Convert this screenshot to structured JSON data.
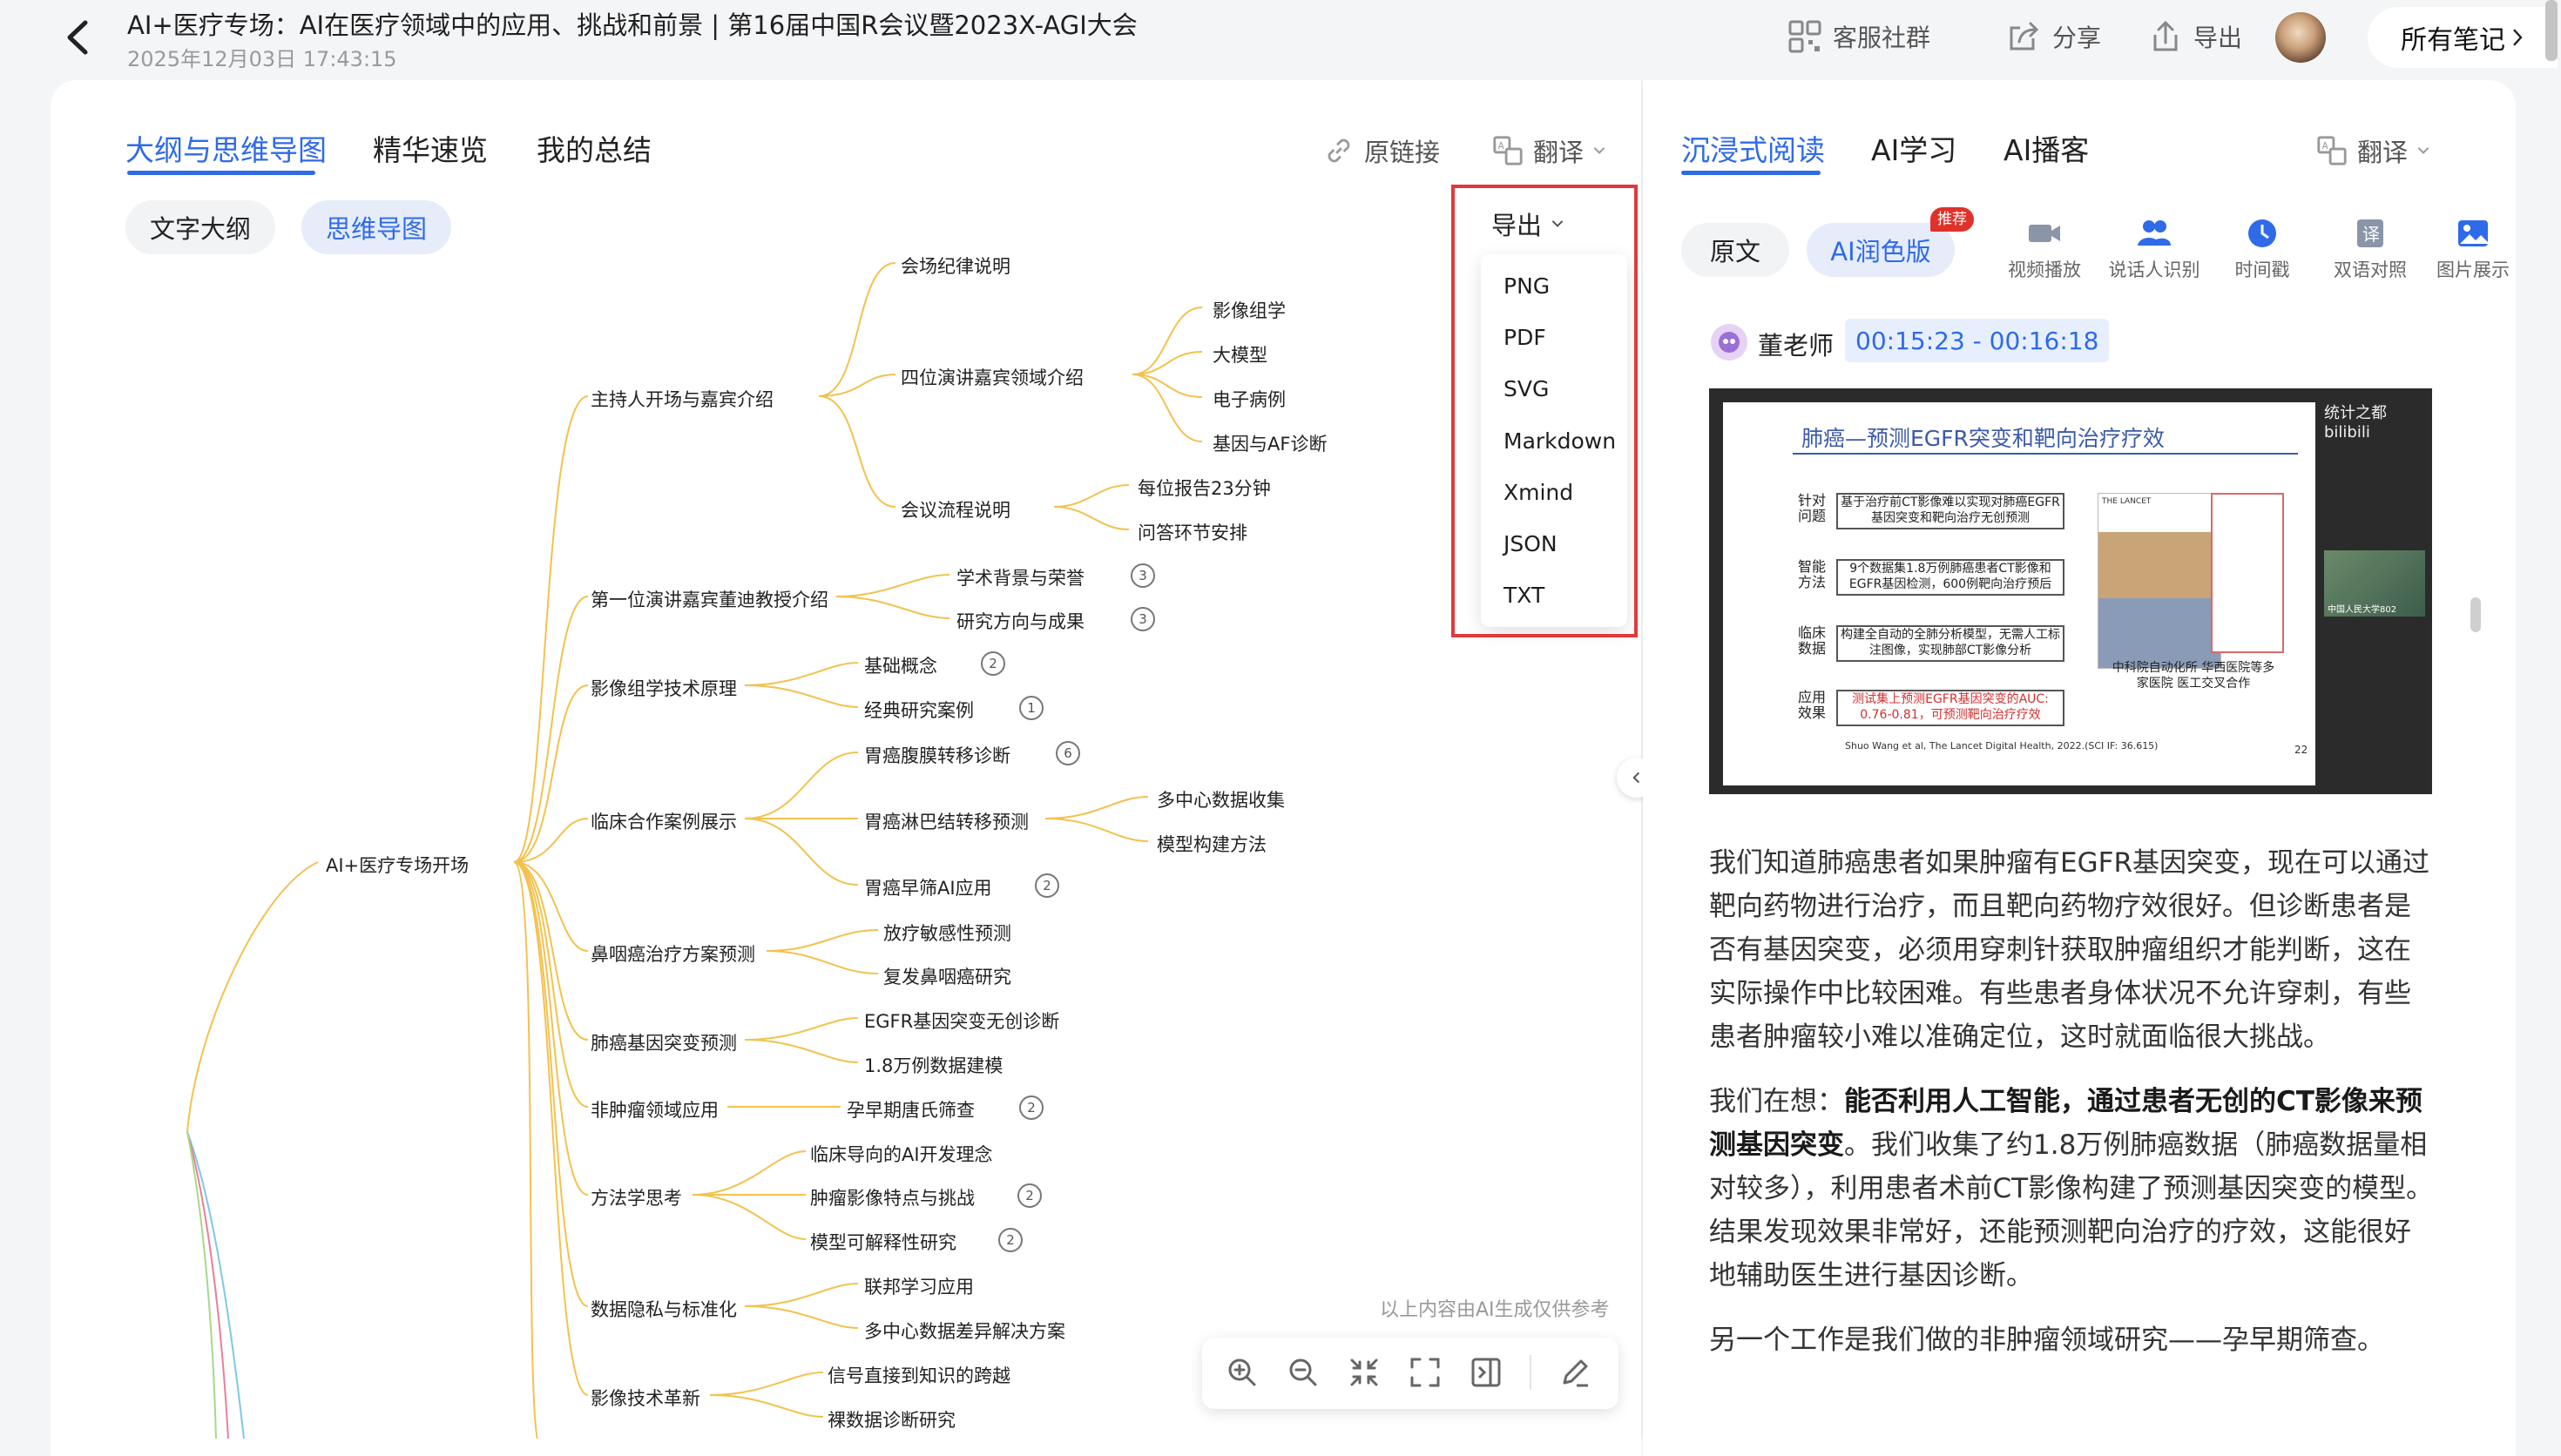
{
  "header": {
    "title": "AI+医疗专场：AI在医疗领域中的应用、挑战和前景 | 第16届中国R会议暨2023X-AGI大会",
    "date": "2025年12月03日 17:43:15",
    "actions": {
      "community": "客服社群",
      "share": "分享",
      "export": "导出",
      "all_notes": "所有笔记"
    }
  },
  "left_panel": {
    "tabs": [
      "大纲与思维导图",
      "精华速览",
      "我的总结"
    ],
    "tools": {
      "source_link": "原链接",
      "translate": "翻译"
    },
    "view_toggle": [
      "文字大纲",
      "思维导图"
    ],
    "export_label": "导出",
    "export_options": [
      "PNG",
      "PDF",
      "SVG",
      "Markdown",
      "Xmind",
      "JSON",
      "TXT"
    ],
    "disclaimer": "以上内容由AI生成仅供参考",
    "mindmap": {
      "root": "AI+医疗专场开场",
      "branches": [
        {
          "label": "主持人开场与嘉宾介绍",
          "children": [
            {
              "label": "会场纪律说明"
            },
            {
              "label": "四位演讲嘉宾领域介绍",
              "children": [
                "影像组学",
                "大模型",
                "电子病例",
                "基因与AF诊断"
              ]
            },
            {
              "label": "会议流程说明",
              "children": [
                "每位报告23分钟",
                "问答环节安排"
              ]
            }
          ]
        },
        {
          "label": "第一位演讲嘉宾董迪教授介绍",
          "children": [
            {
              "label": "学术背景与荣誉",
              "badge": "3"
            },
            {
              "label": "研究方向与成果",
              "badge": "3"
            }
          ]
        },
        {
          "label": "影像组学技术原理",
          "children": [
            {
              "label": "基础概念",
              "badge": "2"
            },
            {
              "label": "经典研究案例",
              "badge": "1"
            }
          ]
        },
        {
          "label": "临床合作案例展示",
          "children": [
            {
              "label": "胃癌腹膜转移诊断",
              "badge": "6"
            },
            {
              "label": "胃癌淋巴结转移预测",
              "children": [
                "多中心数据收集",
                "模型构建方法"
              ]
            },
            {
              "label": "胃癌早筛AI应用",
              "badge": "2"
            }
          ]
        },
        {
          "label": "鼻咽癌治疗方案预测",
          "children": [
            {
              "label": "放疗敏感性预测"
            },
            {
              "label": "复发鼻咽癌研究"
            }
          ]
        },
        {
          "label": "肺癌基因突变预测",
          "children": [
            {
              "label": "EGFR基因突变无创诊断"
            },
            {
              "label": "1.8万例数据建模"
            }
          ]
        },
        {
          "label": "非肿瘤领域应用",
          "children": [
            {
              "label": "孕早期唐氏筛查",
              "badge": "2"
            }
          ]
        },
        {
          "label": "方法学思考",
          "children": [
            {
              "label": "临床导向的AI开发理念"
            },
            {
              "label": "肿瘤影像特点与挑战",
              "badge": "2"
            },
            {
              "label": "模型可解释性研究",
              "badge": "2"
            }
          ]
        },
        {
          "label": "数据隐私与标准化",
          "children": [
            {
              "label": "联邦学习应用"
            },
            {
              "label": "多中心数据差异解决方案"
            }
          ]
        },
        {
          "label": "影像技术革新",
          "children": [
            {
              "label": "信号直接到知识的跨越"
            },
            {
              "label": "裸数据诊断研究"
            }
          ]
        }
      ]
    }
  },
  "right_panel": {
    "tabs": [
      "沉浸式阅读",
      "AI学习",
      "AI播客"
    ],
    "translate": "翻译",
    "modes": {
      "original": "原文",
      "polished": "AI润色版",
      "recommend_badge": "推荐"
    },
    "tools": [
      "视频播放",
      "说话人识别",
      "时间戳",
      "双语对照",
      "图片展示"
    ],
    "speaker": "董老师",
    "timestamp": "00:15:23 - 00:16:18",
    "slide": {
      "title": "肺癌—预测EGFR突变和靶向治疗疗效",
      "watermark": "统计之都 bilibili",
      "rows": [
        {
          "label": "针对问题",
          "text": "基于治疗前CT影像难以实现对肺癌EGFR基因突变和靶向治疗无创预测"
        },
        {
          "label": "智能方法",
          "text": "9个数据集1.8万例肺癌患者CT影像和EGFR基因检测，600例靶向治疗预后"
        },
        {
          "label": "临床数据",
          "text": "构建全自动的全肺分析模型，无需人工标注图像，实现肺部CT影像分析"
        },
        {
          "label": "应用效果",
          "text": "测试集上预测EGFR基因突变的AUC: 0.76-0.81，可预测靶向治疗疗效"
        }
      ],
      "side_note": "中科院自动化所 华西医院等多家医院 医工交叉合作",
      "citation": "Shuo Wang et al, The Lancet Digital Health, 2022.(SCI IF: 36.615)",
      "page": "22",
      "journal": "THE LANCET",
      "camera_caption": "中国人民大学802"
    },
    "paragraphs": [
      {
        "text": "我们知道肺癌患者如果肿瘤有EGFR基因突变，现在可以通过靶向药物进行治疗，而且靶向药物疗效很好。但诊断患者是否有基因突变，必须用穿刺针获取肿瘤组织才能判断，这在实际操作中比较困难。有些患者身体状况不允许穿刺，有些患者肿瘤较小难以准确定位，这时就面临很大挑战。"
      },
      {
        "prefix": "我们在想：",
        "bold": "能否利用人工智能，通过患者无创的CT影像来预测基因突变",
        "suffix": "。我们收集了约1.8万例肺癌数据（肺癌数据量相对较多），利用患者术前CT影像构建了预测基因突变的模型。结果发现效果非常好，还能预测靶向治疗的疗效，这能很好地辅助医生进行基因诊断。"
      },
      {
        "text": "另一个工作是我们做的非肿瘤领域研究——孕早期筛查。"
      }
    ]
  },
  "colors": {
    "accent": "#2f6ae8",
    "highlight_border": "#e03a3a",
    "mindmap_line": "#f2c24f",
    "badge_red": "#e0312b"
  }
}
